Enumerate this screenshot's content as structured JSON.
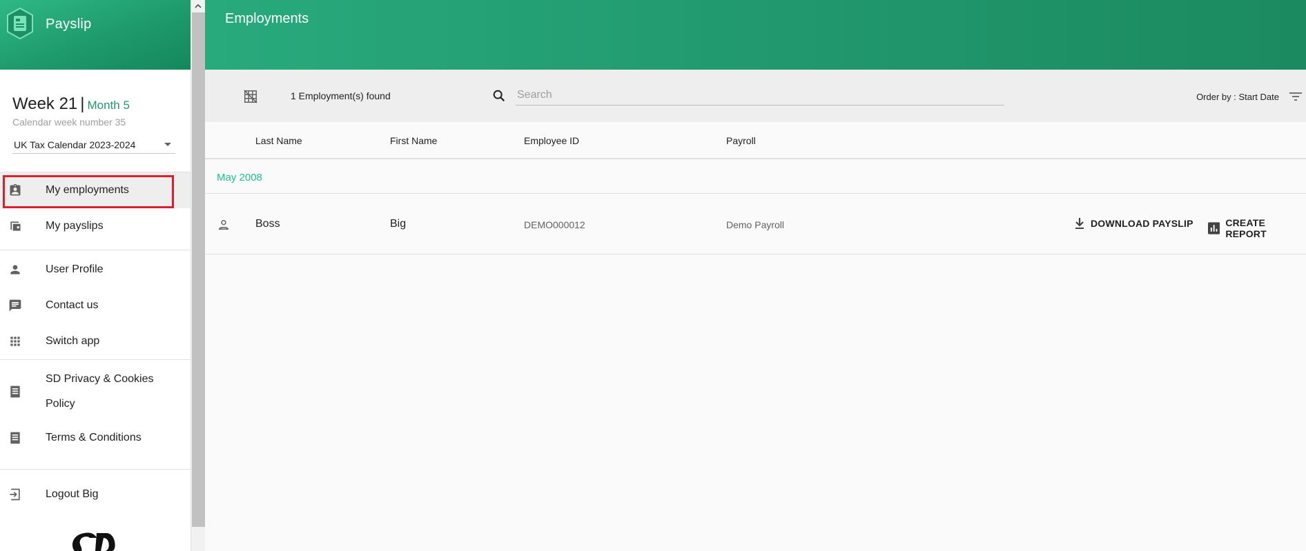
{
  "app": {
    "name": "Payslip"
  },
  "calendar": {
    "week": "Week 21",
    "separator": "|",
    "month": "Month 5",
    "subtitle": "Calendar week number 35",
    "selected": "UK Tax Calendar 2023-2024"
  },
  "nav": {
    "my_employments": "My employments",
    "my_payslips": "My payslips",
    "user_profile": "User Profile",
    "contact_us": "Contact us",
    "switch_app": "Switch app",
    "privacy": "SD Privacy & Cookies Policy",
    "terms": "Terms & Conditions",
    "logout": "Logout Big"
  },
  "page": {
    "title": "Employments"
  },
  "toolbar": {
    "count": "1 Employment(s) found",
    "search_placeholder": "Search",
    "order_by": "Order by : Start Date"
  },
  "table": {
    "columns": [
      "Last Name",
      "First Name",
      "Employee ID",
      "Payroll"
    ],
    "groups": [
      {
        "label": "May 2008",
        "rows": [
          {
            "last_name": "Boss",
            "first_name": "Big",
            "employee_id": "DEMO000012",
            "payroll": "Demo Payroll"
          }
        ]
      }
    ],
    "actions": {
      "download": "DOWNLOAD PAYSLIP",
      "report": "CREATE REPORT"
    }
  },
  "colors": {
    "brand_green": "#1e9a6c",
    "accent_green": "#1ec28a",
    "highlight_red": "#e01e2b"
  }
}
